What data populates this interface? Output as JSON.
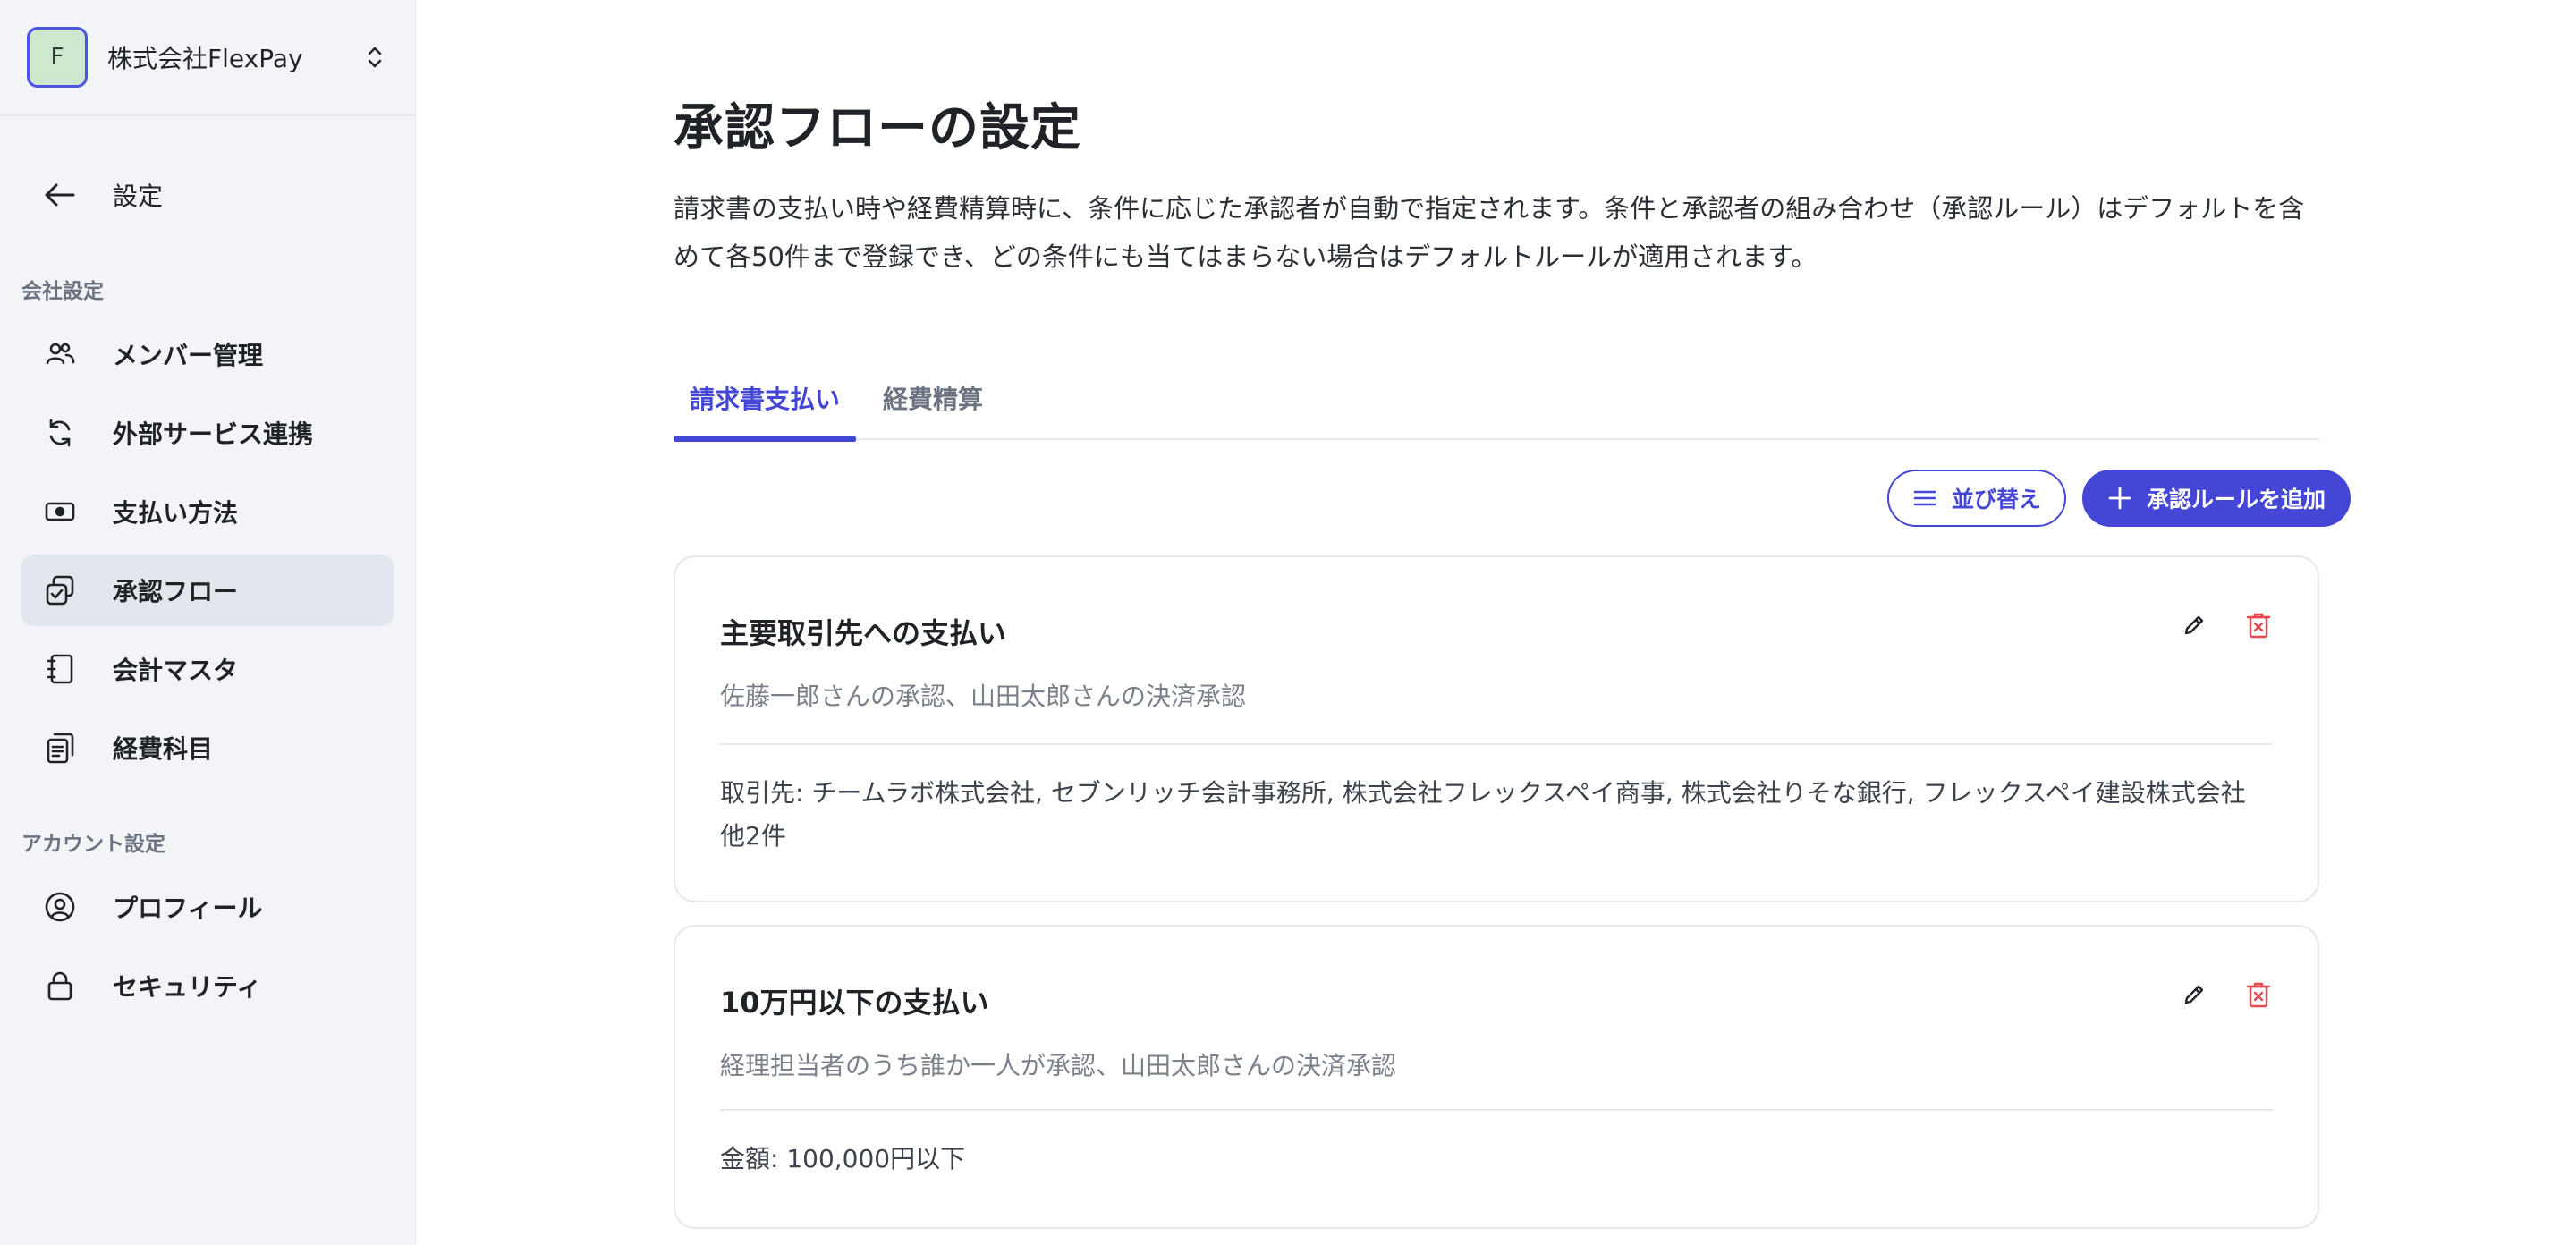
{
  "organization": {
    "avatar_letter": "F",
    "name": "株式会社FlexPay"
  },
  "sidebar": {
    "back_label": "設定",
    "company_section_label": "会社設定",
    "company_items": [
      {
        "label": "メンバー管理",
        "icon": "users-icon",
        "active": false
      },
      {
        "label": "外部サービス連携",
        "icon": "sync-icon",
        "active": false
      },
      {
        "label": "支払い方法",
        "icon": "banknote-icon",
        "active": false
      },
      {
        "label": "承認フロー",
        "icon": "approval-flow-icon",
        "active": true
      },
      {
        "label": "会計マスタ",
        "icon": "notebook-icon",
        "active": false
      },
      {
        "label": "経費科目",
        "icon": "documents-icon",
        "active": false
      }
    ],
    "account_section_label": "アカウント設定",
    "account_items": [
      {
        "label": "プロフィール",
        "icon": "user-circle-icon",
        "active": false
      },
      {
        "label": "セキュリティ",
        "icon": "lock-icon",
        "active": false
      }
    ]
  },
  "main": {
    "title": "承認フローの設定",
    "description": "請求書の支払い時や経費精算時に、条件に応じた承認者が自動で指定されます。条件と承認者の組み合わせ（承認ルール）はデフォルトを含めて各50件まで登録でき、どの条件にも当てはまらない場合はデフォルトルールが適用されます。",
    "tabs": [
      {
        "label": "請求書支払い",
        "active": true
      },
      {
        "label": "経費精算",
        "active": false
      }
    ],
    "toolbar": {
      "sort_label": "並び替え",
      "add_label": "承認ルールを追加"
    },
    "rules": [
      {
        "title": "主要取引先への支払い",
        "approvers": "佐藤一郎さんの承認、山田太郎さんの決済承認",
        "condition": "取引先: チームラボ株式会社, セブンリッチ会計事務所, 株式会社フレックスペイ商事, 株式会社りそな銀行, フレックスペイ建設株式会社 他2件"
      },
      {
        "title": "10万円以下の支払い",
        "approvers": "経理担当者のうち誰か一人が承認、山田太郎さんの決済承認",
        "condition": "金額: 100,000円以下"
      }
    ]
  },
  "colors": {
    "accent": "#4447d6",
    "danger": "#e5484d",
    "sidebar_bg": "#f2f4f7",
    "active_nav_bg": "#e2e6ed",
    "org_avatar_bg": "#cde8cf"
  }
}
